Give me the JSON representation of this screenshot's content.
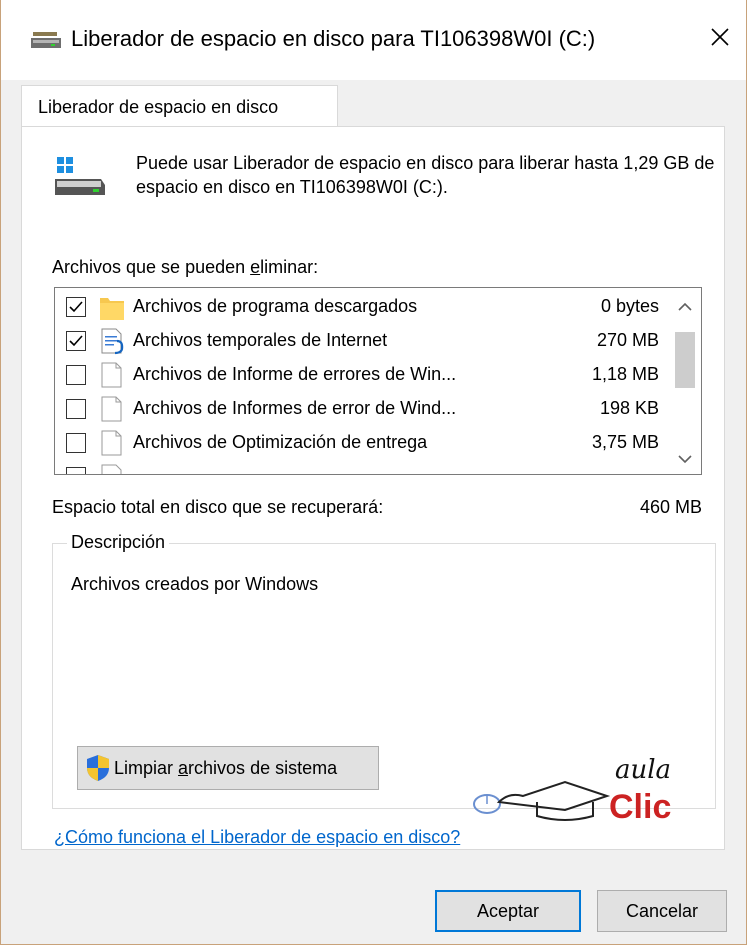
{
  "window": {
    "title": "Liberador de espacio en disco para TI106398W0I (C:)",
    "close_glyph": "✕"
  },
  "tab": {
    "label": "Liberador de espacio en disco"
  },
  "intro": {
    "text": "Puede usar Liberador de espacio en disco para liberar hasta 1,29 GB de espacio en disco en TI106398W0I (C:)."
  },
  "files": {
    "label_before": "Archivos que se pueden ",
    "label_accel": "e",
    "label_after": "liminar:",
    "items": [
      {
        "name": "Archivos de programa descargados",
        "size": "0 bytes",
        "checked": true,
        "icon": "folder-icon"
      },
      {
        "name": "Archivos temporales de Internet",
        "size": "270 MB",
        "checked": true,
        "icon": "internet-file-icon"
      },
      {
        "name": "Archivos de Informe de errores de Win...",
        "size": "1,18 MB",
        "checked": false,
        "icon": "blank-file-icon"
      },
      {
        "name": "Archivos de Informes de error de Wind...",
        "size": "198 KB",
        "checked": false,
        "icon": "blank-file-icon"
      },
      {
        "name": "Archivos de Optimización de entrega",
        "size": "3,75 MB",
        "checked": false,
        "icon": "blank-file-icon"
      }
    ]
  },
  "total": {
    "label": "Espacio total en disco que se recuperará:",
    "value": "460 MB"
  },
  "description": {
    "legend": "Descripción",
    "text": "Archivos creados por Windows"
  },
  "clean_button": {
    "label_before": "Limpiar ",
    "label_accel": "a",
    "label_after": "rchivos de sistema"
  },
  "watermark": {
    "line1": "aula",
    "line2": "Clic"
  },
  "help_link": {
    "text": "¿Cómo funciona el Liberador de espacio en disco?"
  },
  "buttons": {
    "ok": "Aceptar",
    "cancel": "Cancelar"
  },
  "colors": {
    "accent": "#0078d7",
    "link": "#0066cc",
    "watermark_red": "#cc2222"
  }
}
